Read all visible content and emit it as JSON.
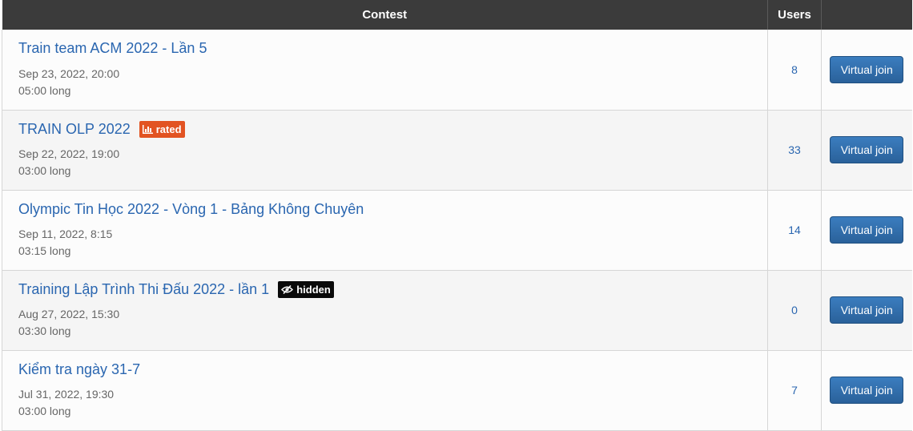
{
  "table": {
    "headers": {
      "contest": "Contest",
      "users": "Users",
      "action": ""
    },
    "rows": [
      {
        "title": "Train team ACM 2022 - Lần 5",
        "badge": null,
        "date": "Sep 23, 2022, 20:00",
        "duration": "05:00 long",
        "users": "8",
        "button": "Virtual join"
      },
      {
        "title": "TRAIN OLP 2022",
        "badge": {
          "type": "rated",
          "label": "rated",
          "icon": "bar-chart-icon",
          "color": "#e25322"
        },
        "date": "Sep 22, 2022, 19:00",
        "duration": "03:00 long",
        "users": "33",
        "button": "Virtual join"
      },
      {
        "title": "Olympic Tin Học 2022 - Vòng 1 - Bảng Không Chuyên",
        "badge": null,
        "date": "Sep 11, 2022, 8:15",
        "duration": "03:15 long",
        "users": "14",
        "button": "Virtual join"
      },
      {
        "title": "Training Lập Trình Thi Đấu 2022 - lần 1",
        "badge": {
          "type": "hidden",
          "label": "hidden",
          "icon": "eye-slash-icon",
          "color": "#0a0a0a"
        },
        "date": "Aug 27, 2022, 15:30",
        "duration": "03:30 long",
        "users": "0",
        "button": "Virtual join"
      },
      {
        "title": "Kiểm tra ngày 31-7",
        "badge": null,
        "date": "Jul 31, 2022, 19:30",
        "duration": "03:00 long",
        "users": "7",
        "button": "Virtual join"
      }
    ]
  },
  "colors": {
    "header_bg": "#3b3b3b",
    "link": "#2a66b0",
    "button": "#2e6da4"
  }
}
